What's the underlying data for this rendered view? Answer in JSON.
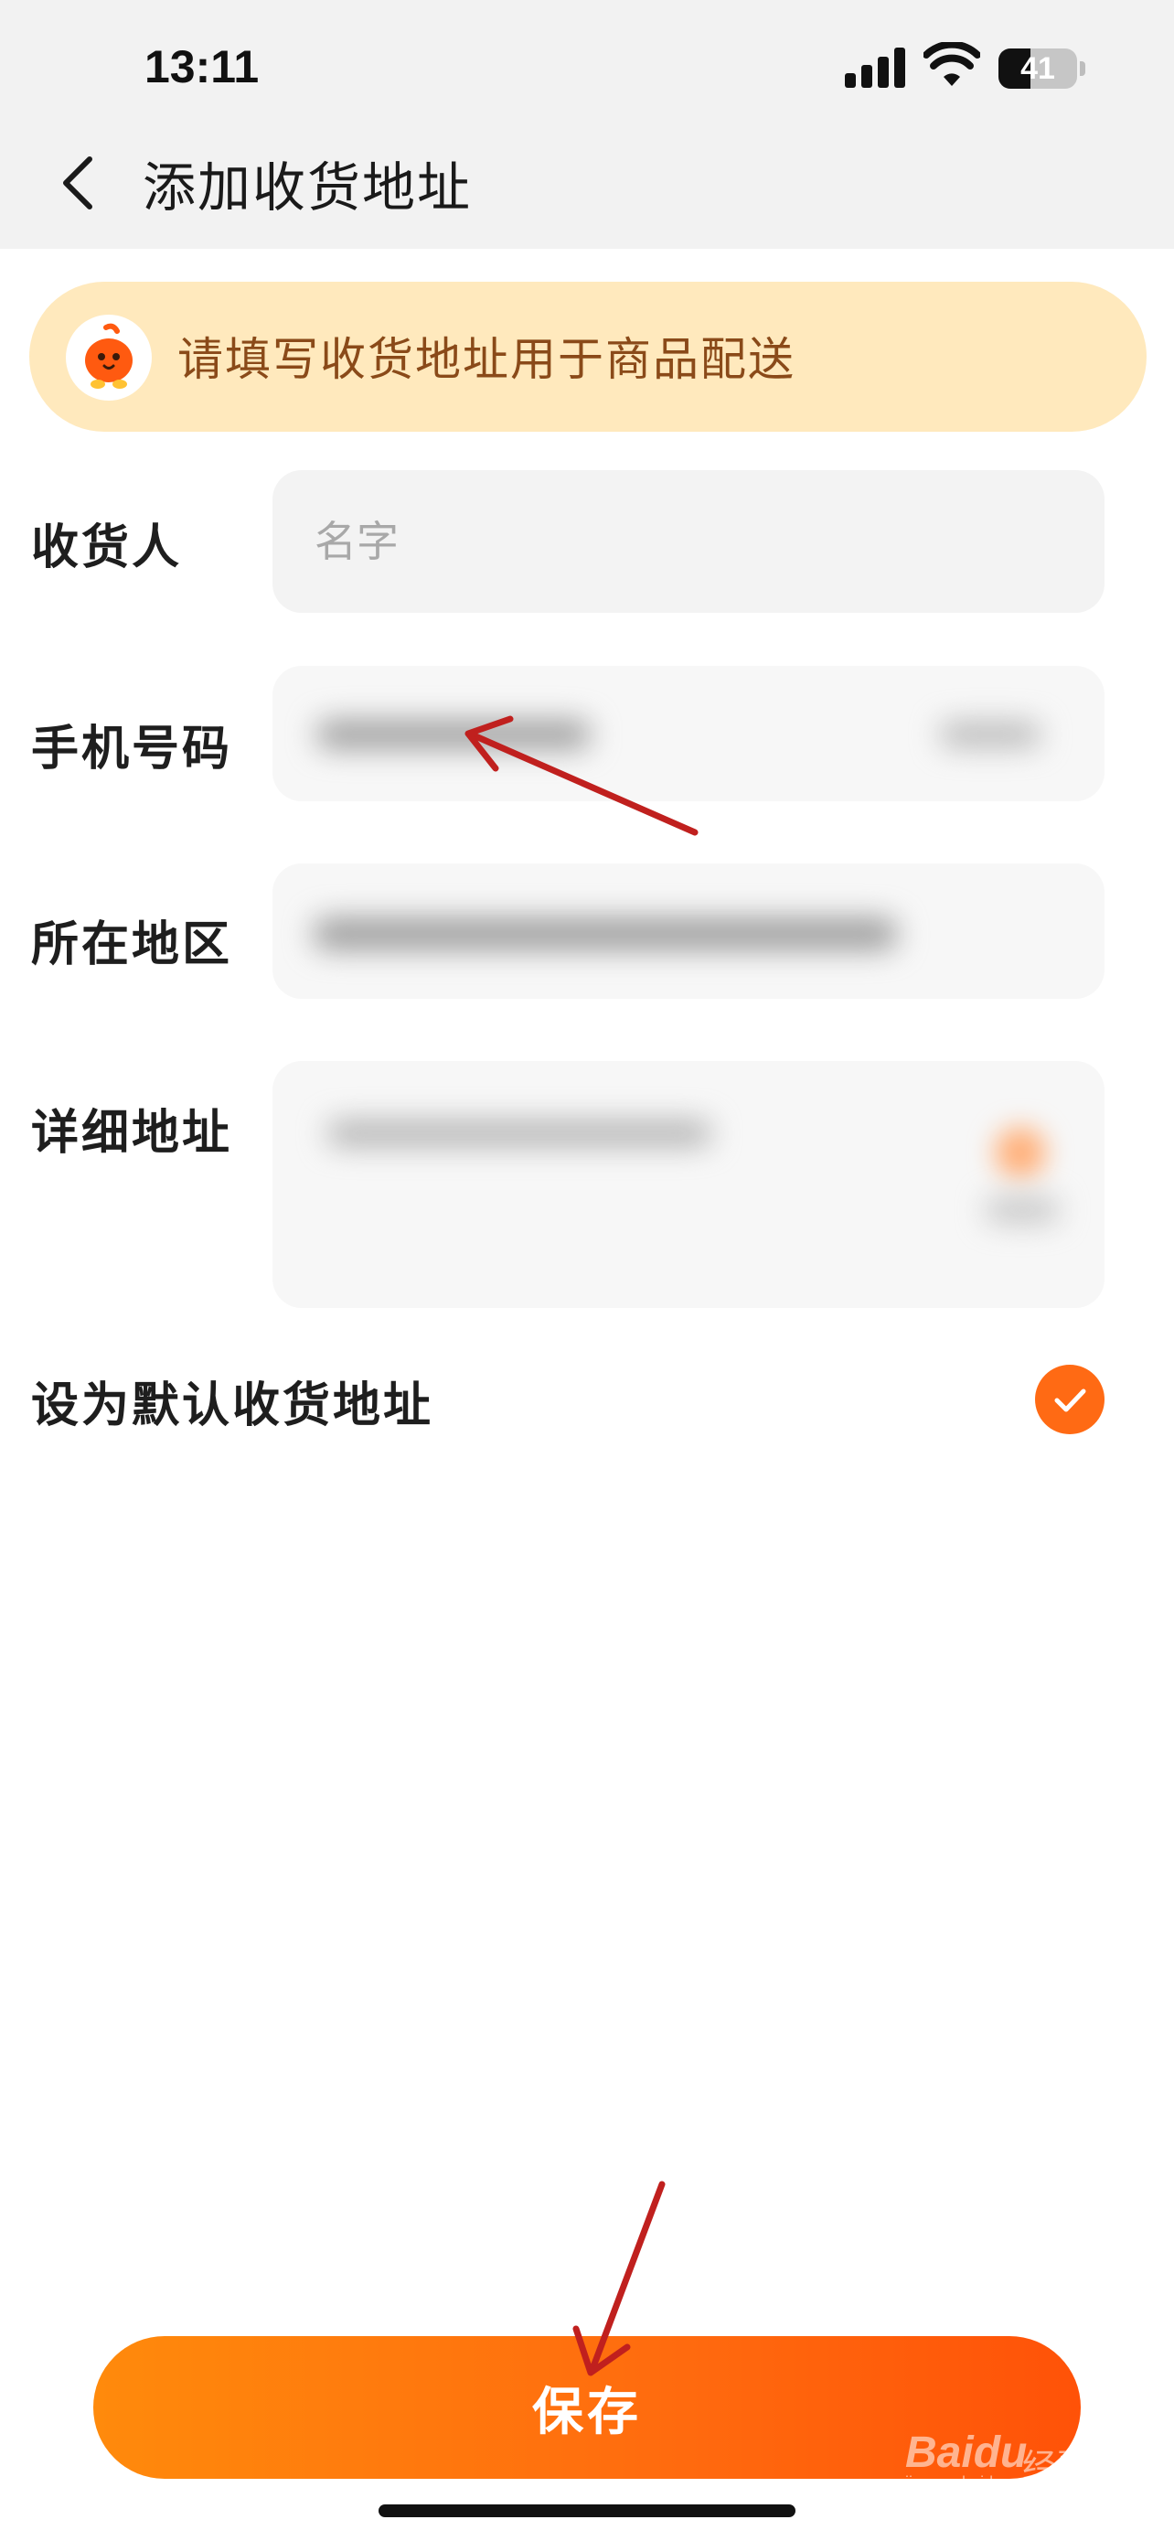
{
  "status_bar": {
    "time": "13:11",
    "battery_level": "41"
  },
  "header": {
    "title": "添加收货地址"
  },
  "banner": {
    "text": "请填写收货地址用于商品配送"
  },
  "form": {
    "recipient": {
      "label": "收货人",
      "placeholder": "名字"
    },
    "phone": {
      "label": "手机号码"
    },
    "region": {
      "label": "所在地区"
    },
    "detail_address": {
      "label": "详细地址"
    },
    "default_address": {
      "label": "设为默认收货地址",
      "checked": true
    }
  },
  "save_button": {
    "label": "保存"
  },
  "watermark": {
    "brand": "Baidu",
    "brand_cn": "经验",
    "url": "jingyan.baidu.com"
  },
  "colors": {
    "accent": "#ff6a14",
    "banner_bg": "#ffe9bd",
    "banner_text": "#8a4a19",
    "annotation_arrow": "#c0201e"
  }
}
